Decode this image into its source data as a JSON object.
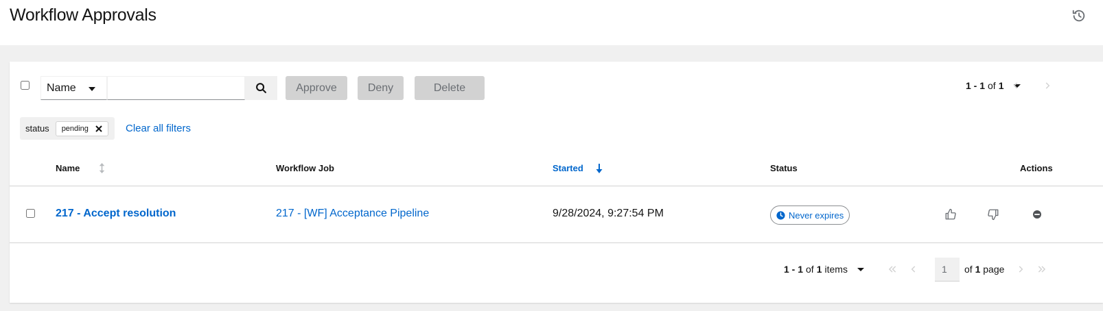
{
  "header": {
    "title": "Workflow Approvals",
    "history_icon": "history-icon"
  },
  "toolbar": {
    "filter_select": "Name",
    "search_value": "",
    "search_icon": "search-icon",
    "approve_label": "Approve",
    "deny_label": "Deny",
    "delete_label": "Delete",
    "pager_range": "1 - 1",
    "pager_of": "of",
    "pager_total": "1"
  },
  "filters": {
    "category": "status",
    "chip": "pending",
    "clear_label": "Clear all filters"
  },
  "table": {
    "columns": {
      "name": "Name",
      "workflow_job": "Workflow Job",
      "started": "Started",
      "status": "Status",
      "actions": "Actions"
    },
    "rows": [
      {
        "name": "217 - Accept resolution",
        "workflow_job": "217 - [WF] Acceptance Pipeline",
        "started": "9/28/2024, 9:27:54 PM",
        "status": "Never expires"
      }
    ]
  },
  "footer": {
    "range": "1 - 1",
    "of": "of",
    "total": "1",
    "items_label": "items",
    "page_value": "1",
    "of_page_prefix": "of",
    "page_total": "1",
    "page_label": "page"
  },
  "colors": {
    "link": "#0066cc",
    "disabled_button": "#d2d2d2",
    "page_background": "#f0f0f0"
  }
}
